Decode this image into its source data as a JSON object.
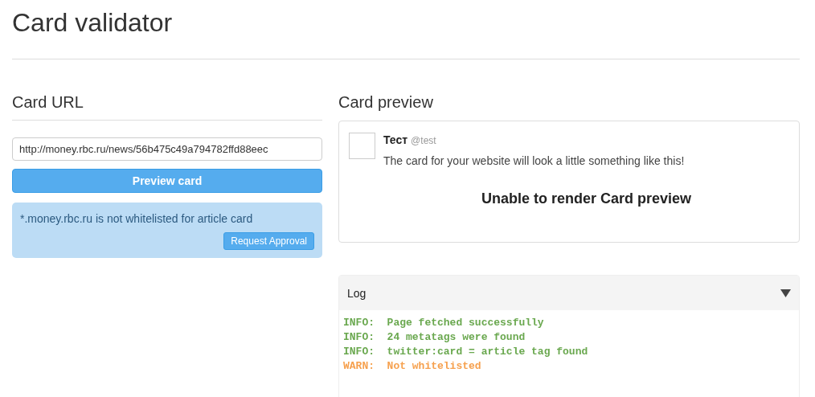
{
  "page": {
    "title": "Card validator"
  },
  "card_url": {
    "heading": "Card URL",
    "url": "http://money.rbc.ru/news/56b475c49a794782ffd88eec",
    "button": "Preview card",
    "alert": {
      "message": "*.money.rbc.ru is not whitelisted for article card",
      "button": "Request Approval"
    }
  },
  "card_preview": {
    "heading": "Card preview",
    "name": "Тест",
    "handle": "@test",
    "text": "The card for your website will look a little something like this!",
    "error": "Unable to render Card preview"
  },
  "log": {
    "title": "Log",
    "lines": [
      {
        "kind": "info",
        "text": "INFO:  Page fetched successfully"
      },
      {
        "kind": "info",
        "text": "INFO:  24 metatags were found"
      },
      {
        "kind": "info",
        "text": "INFO:  twitter:card = article tag found"
      },
      {
        "kind": "warn",
        "text": "WARN:  Not whitelisted"
      }
    ]
  }
}
